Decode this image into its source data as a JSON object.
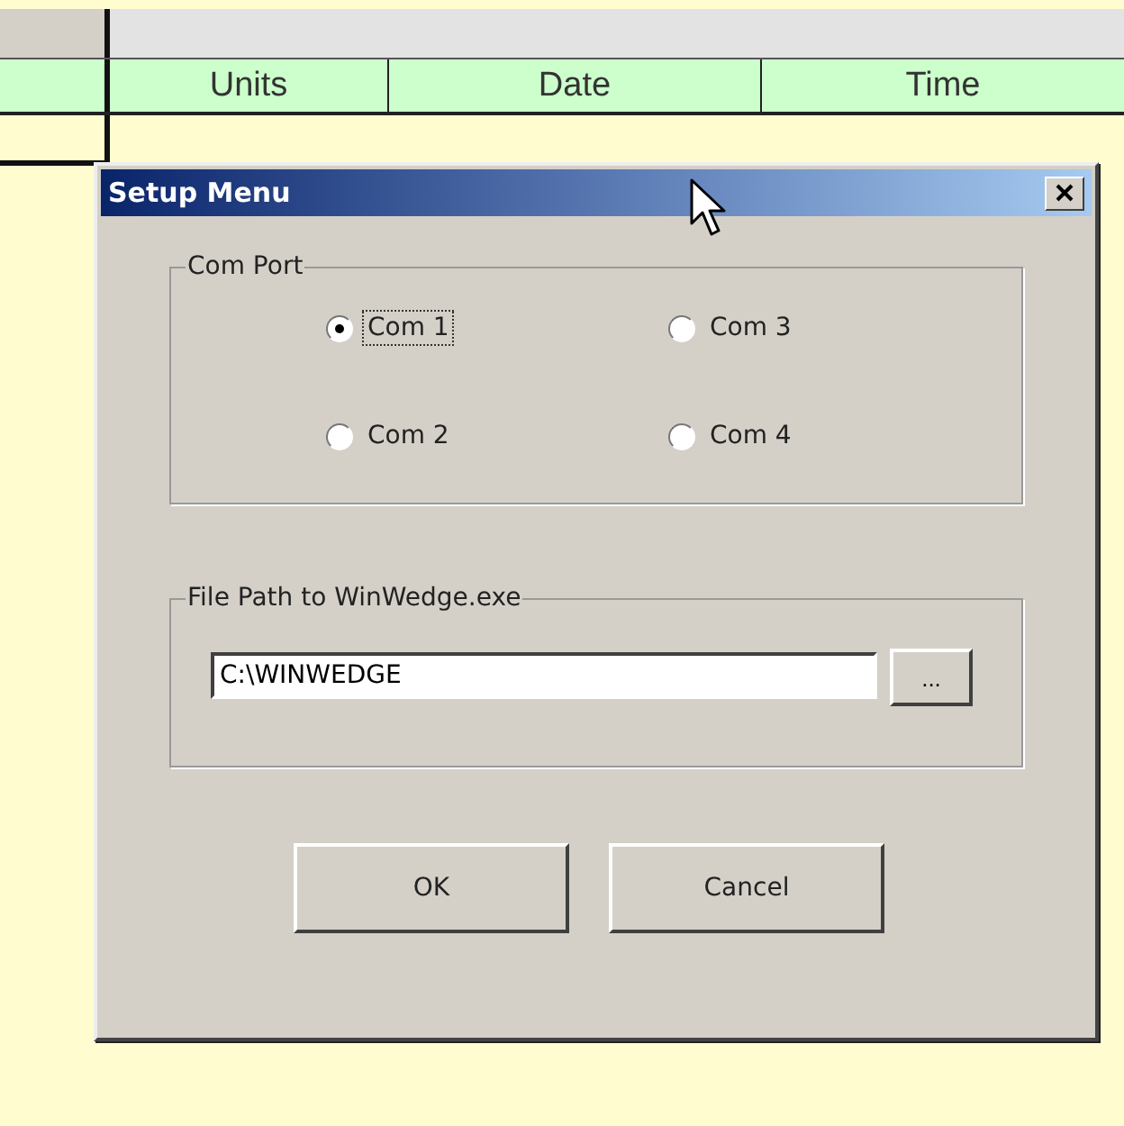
{
  "sheet": {
    "columns": [
      "Units",
      "Date",
      "Time"
    ]
  },
  "dialog": {
    "title": "Setup Menu",
    "com_port": {
      "label": "Com Port",
      "options": [
        {
          "label": "Com 1",
          "selected": true,
          "focused": true
        },
        {
          "label": "Com 2",
          "selected": false,
          "focused": false
        },
        {
          "label": "Com 3",
          "selected": false,
          "focused": false
        },
        {
          "label": "Com 4",
          "selected": false,
          "focused": false
        }
      ]
    },
    "file_path": {
      "label": "File Path to WinWedge.exe",
      "value": "C:\\WINWEDGE",
      "browse_button": "..."
    },
    "buttons": [
      "OK",
      "Cancel"
    ]
  }
}
